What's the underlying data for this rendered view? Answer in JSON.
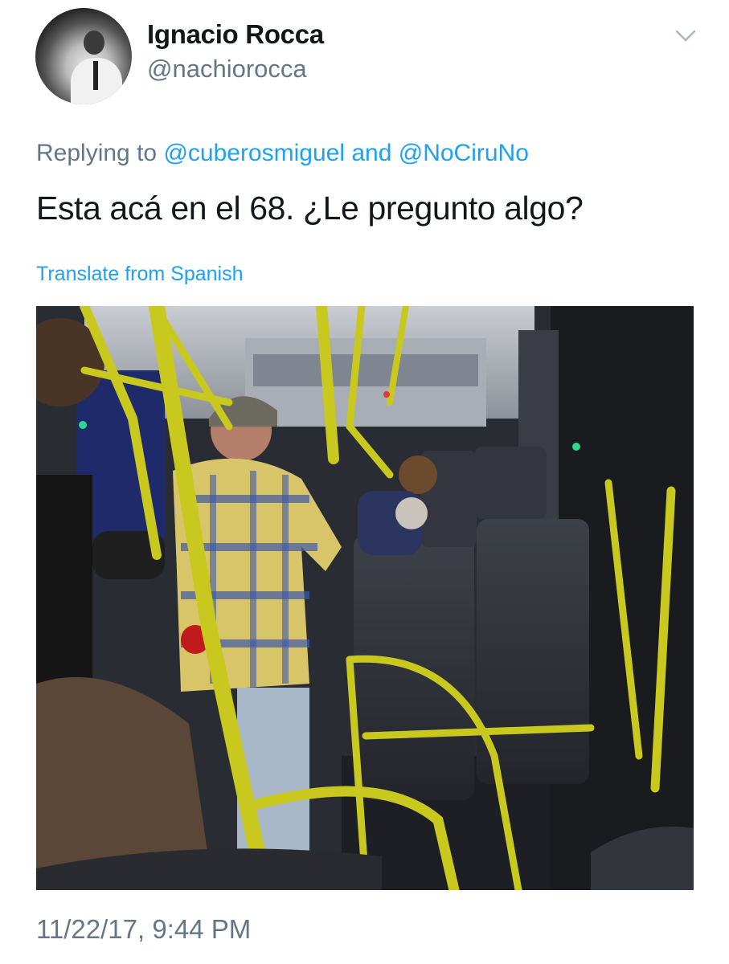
{
  "user": {
    "name": "Ignacio Rocca",
    "handle": "@nachiorocca"
  },
  "reply": {
    "prefix": "Replying to",
    "mention_1": "@cuberosmiguel",
    "joiner": "and",
    "mention_2": "@NoCiruNo"
  },
  "tweet": {
    "text": "Esta acá en el 68. ¿Le pregunto algo?",
    "translate_label": "Translate from Spanish",
    "timestamp": "11/22/17, 9:44 PM"
  },
  "colors": {
    "link": "#1da1f2",
    "secondary": "#657786",
    "primary_text": "#14171a",
    "pole_yellow": "#c8c81e"
  },
  "icons": {
    "menu": "chevron-down-icon"
  }
}
